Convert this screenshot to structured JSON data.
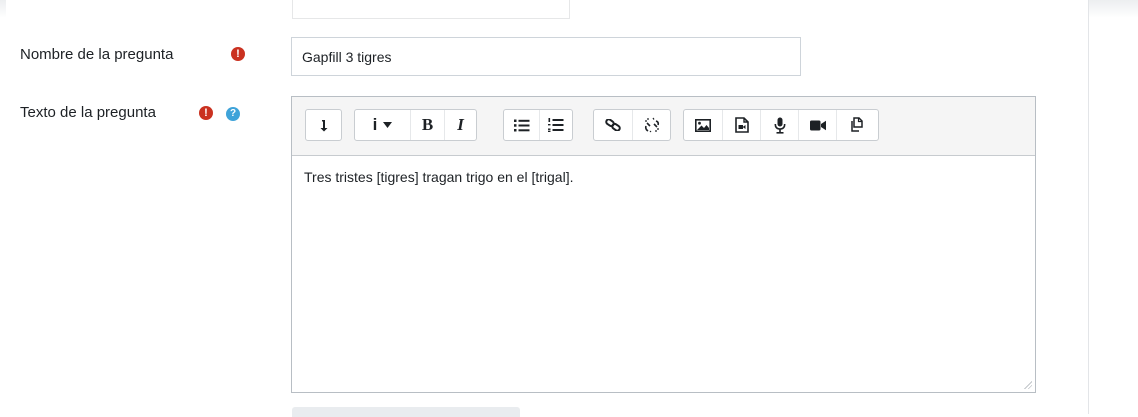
{
  "form": {
    "name_label": "Nombre de la pregunta",
    "name_value": "Gapfill 3 tigres",
    "text_label": "Texto de la pregunta",
    "required_icon": "exclamation-circle-icon",
    "help_icon": "question-circle-icon"
  },
  "editor": {
    "content": "Tres tristes [tigres] tragan trigo en el [trigal].",
    "toolbar": {
      "collapse": "collapse-icon",
      "italic_label": "I",
      "bold_label": "B",
      "info_icon": "i",
      "buttons": [
        "collapse-icon",
        "info-icon",
        "bold-icon",
        "italic-icon",
        "unordered-list-icon",
        "ordered-list-icon",
        "link-icon",
        "unlink-icon",
        "image-icon",
        "media-icon",
        "record-audio-icon",
        "record-video-icon",
        "manage-files-icon"
      ]
    }
  },
  "colors": {
    "required": "#ca3120",
    "help": "#3fa3d9",
    "border": "#ced4da",
    "toolbar_bg": "#f5f5f5"
  }
}
